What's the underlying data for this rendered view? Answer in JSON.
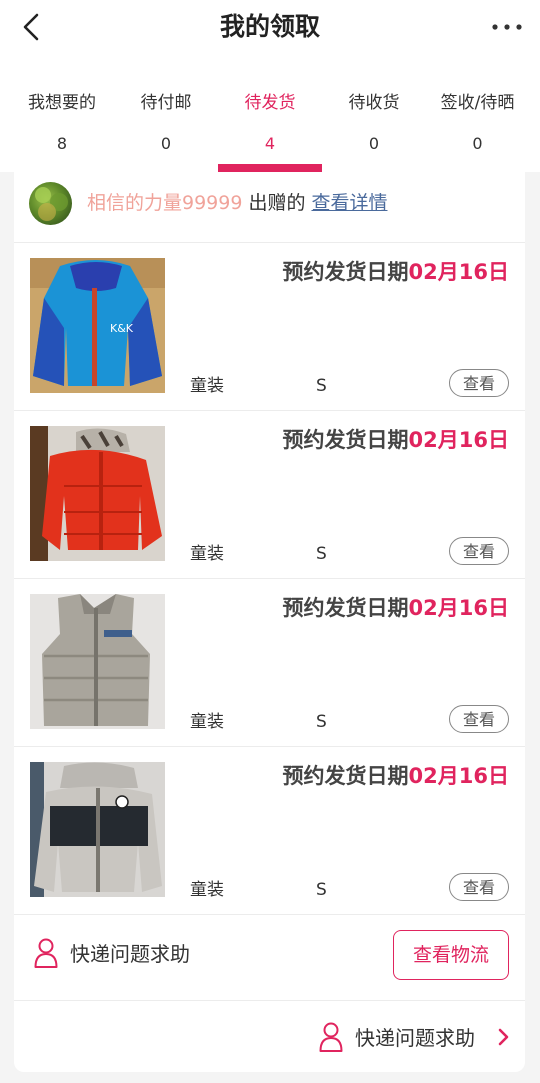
{
  "header": {
    "title": "我的领取",
    "back_icon": "chevron-left-icon",
    "more_icon": "more-dots-icon"
  },
  "tabs": [
    {
      "label": "我想要的",
      "count": "8"
    },
    {
      "label": "待付邮",
      "count": "0"
    },
    {
      "label": "待发货",
      "count": "4"
    },
    {
      "label": "待收货",
      "count": "0"
    },
    {
      "label": "签收/待晒",
      "count": "0"
    }
  ],
  "active_tab": "待发货",
  "giver": {
    "name": "相信的力量99999",
    "action": "出赠的",
    "link": "查看详情"
  },
  "items": [
    {
      "ship_label": "预约发货日期",
      "ship_date": "02月16日",
      "category": "童装",
      "size": "S",
      "view": "查看",
      "image": "blue kids jacket photo"
    },
    {
      "ship_label": "预约发货日期",
      "ship_date": "02月16日",
      "category": "童装",
      "size": "S",
      "view": "查看",
      "image": "red kids puffer jacket photo"
    },
    {
      "ship_label": "预约发货日期",
      "ship_date": "02月16日",
      "category": "童装",
      "size": "S",
      "view": "查看",
      "image": "grey kids vest photo"
    },
    {
      "ship_label": "预约发货日期",
      "ship_date": "02月16日",
      "category": "童装",
      "size": "S",
      "view": "查看",
      "image": "grey and black kids jacket photo"
    }
  ],
  "help": {
    "label": "快递问题求助",
    "logistics_button": "查看物流",
    "bottom_label": "快递问题求助"
  },
  "colors": {
    "accent": "#e0245e",
    "giver_name": "#f0a39a",
    "link": "#4a6a9c"
  }
}
